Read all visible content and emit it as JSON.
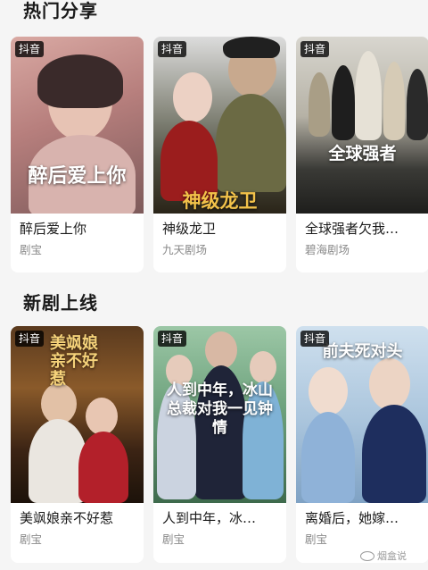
{
  "sections": [
    {
      "title": "热门分享",
      "cards": [
        {
          "badge": "抖音",
          "title": "醉后爱上你",
          "source": "剧宝",
          "poster_text": "醉后爱上你"
        },
        {
          "badge": "抖音",
          "title": "神级龙卫",
          "source": "九天剧场",
          "poster_text": "神级龙卫"
        },
        {
          "badge": "抖音",
          "title": "全球强者欠我…",
          "source": "碧海剧场",
          "poster_text": "全球强者"
        }
      ]
    },
    {
      "title": "新剧上线",
      "cards": [
        {
          "badge": "抖音",
          "title": "美飒娘亲不好惹",
          "source": "剧宝",
          "poster_text": "美飒娘亲不好惹"
        },
        {
          "badge": "抖音",
          "title": "人到中年，冰…",
          "source": "剧宝",
          "poster_text": "人到中年，冰山总裁对我一见钟情"
        },
        {
          "badge": "抖音",
          "title": "离婚后，她嫁…",
          "source": "剧宝",
          "poster_text": "前夫死对头"
        }
      ]
    }
  ],
  "watermark": "烟盒说",
  "colors": {
    "card_bg": "#ffffff",
    "page_bg": "#f5f5f5",
    "title": "#1a1a1a",
    "source": "#8a8a8a"
  }
}
